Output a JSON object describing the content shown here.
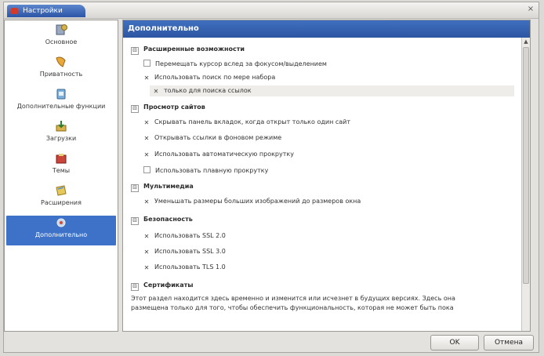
{
  "window": {
    "title": "Настройки",
    "close_glyph": "×"
  },
  "sidebar": {
    "items": [
      {
        "label": "Основное",
        "icon": "general-icon"
      },
      {
        "label": "Приватность",
        "icon": "privacy-icon"
      },
      {
        "label": "Дополнительные функции",
        "icon": "features-icon"
      },
      {
        "label": "Загрузки",
        "icon": "downloads-icon"
      },
      {
        "label": "Темы",
        "icon": "themes-icon"
      },
      {
        "label": "Расширения",
        "icon": "extensions-icon"
      },
      {
        "label": "Дополнительно",
        "icon": "advanced-icon",
        "selected": true
      }
    ]
  },
  "main": {
    "header": "Дополнительно",
    "sections": [
      {
        "title": "Расширенные возможности",
        "options": [
          {
            "label": "Перемещать курсор вслед за фокусом/выделением",
            "checked": false
          },
          {
            "label": "Использовать поиск по мере набора",
            "checked": true
          }
        ],
        "sub_option": {
          "label": "только для поиска ссылок",
          "checked": true
        }
      },
      {
        "title": "Просмотр сайтов",
        "options": [
          {
            "label": "Скрывать панель вкладок, когда открыт только один сайт",
            "checked": true
          },
          {
            "label": "Открывать ссылки в фоновом режиме",
            "checked": true
          },
          {
            "label": "Использовать автоматическую прокрутку",
            "checked": true
          },
          {
            "label": "Использовать плавную прокрутку",
            "checked": false
          }
        ]
      },
      {
        "title": "Мультимедиа",
        "options": [
          {
            "label": "Уменьшать размеры больших изображений до размеров окна",
            "checked": true
          }
        ]
      },
      {
        "title": "Безопасность",
        "options": [
          {
            "label": "Использовать SSL 2.0",
            "checked": true
          },
          {
            "label": "Использовать SSL 3.0",
            "checked": true
          },
          {
            "label": "Использовать TLS 1.0",
            "checked": true
          }
        ]
      },
      {
        "title": "Сертификаты",
        "note_line1": "Этот раздел находится здесь временно и изменится или исчезнет в будущих версиях. Здесь она",
        "note_line2": "размещена только для того, чтобы обеспечить функциональность, которая не может быть пока"
      }
    ],
    "section_toggle_glyph": "⊟"
  },
  "checkbox_glyph": "✕",
  "buttons": {
    "ok": "OK",
    "cancel": "Отмена"
  },
  "colors": {
    "accent": "#3d72c8",
    "header": "#2d56a2"
  }
}
